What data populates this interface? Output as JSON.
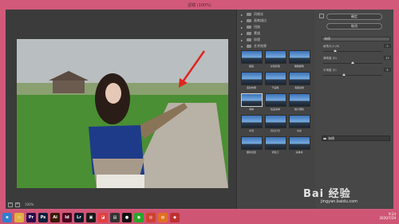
{
  "window": {
    "title": "滤镜 (100%)"
  },
  "preview": {
    "zoom": "100%",
    "zoom_out": "−",
    "zoom_in": "+"
  },
  "gallery": {
    "categories": [
      {
        "label": "风格化",
        "expanded": false
      },
      {
        "label": "画笔描边",
        "expanded": false
      },
      {
        "label": "扭曲",
        "expanded": false
      },
      {
        "label": "素描",
        "expanded": false
      },
      {
        "label": "纹理",
        "expanded": false
      },
      {
        "label": "艺术效果",
        "expanded": true
      }
    ],
    "filters": [
      "壁画",
      "彩色铅笔",
      "粗糙蜡笔",
      "底纹效果",
      "干画笔",
      "海报边缘",
      "海绵",
      "绘画涂抹",
      "胶片颗粒",
      "木刻",
      "霓虹灯光",
      "水彩",
      "塑料包装",
      "调色刀",
      "涂抹棒"
    ],
    "selected_index": 6
  },
  "settings": {
    "ok_label": "确定",
    "cancel_label": "取消",
    "filter_select": "海绵",
    "params": [
      {
        "label": "画笔大小 (B)",
        "value": "2",
        "level": 0.2
      },
      {
        "label": "清晰度 (D)",
        "value": "12",
        "level": 0.5
      },
      {
        "label": "平滑度 (S)",
        "value": "5",
        "level": 0.35
      }
    ],
    "layer_label": "海绵"
  },
  "taskbar": {
    "apps": [
      {
        "name": "browser-icon",
        "glyph": "e",
        "color": "#2f7fd0"
      },
      {
        "name": "folder-icon",
        "glyph": "▭",
        "color": "#e0b040"
      },
      {
        "name": "premiere-icon",
        "glyph": "Pr",
        "color": "#2a0a4a"
      },
      {
        "name": "photoshop-icon",
        "glyph": "Ps",
        "color": "#0c1f3a"
      },
      {
        "name": "illustrator-icon",
        "glyph": "Ai",
        "color": "#3a1a06"
      },
      {
        "name": "indesign-icon",
        "glyph": "Id",
        "color": "#49021f"
      },
      {
        "name": "lightroom-icon",
        "glyph": "Lr",
        "color": "#0a1a2a"
      },
      {
        "name": "media-icon",
        "glyph": "▣",
        "color": "#1a1a1a"
      },
      {
        "name": "capture-icon",
        "glyph": "◪",
        "color": "#e04040"
      },
      {
        "name": "screenshot-icon",
        "glyph": "▤",
        "color": "#333"
      },
      {
        "name": "qq-icon",
        "glyph": "●",
        "color": "#111"
      },
      {
        "name": "wechat-icon",
        "glyph": "◉",
        "color": "#2aa52a"
      },
      {
        "name": "chrome-icon",
        "glyph": "◎",
        "color": "#d04030"
      },
      {
        "name": "firefox-icon",
        "glyph": "◍",
        "color": "#e07020"
      },
      {
        "name": "app-icon",
        "glyph": "◆",
        "color": "#c03030"
      }
    ],
    "time": "9:24",
    "date": "2020/7/29"
  },
  "watermark": {
    "text": "Bai 经验",
    "url": "jingyan.baidu.com"
  }
}
